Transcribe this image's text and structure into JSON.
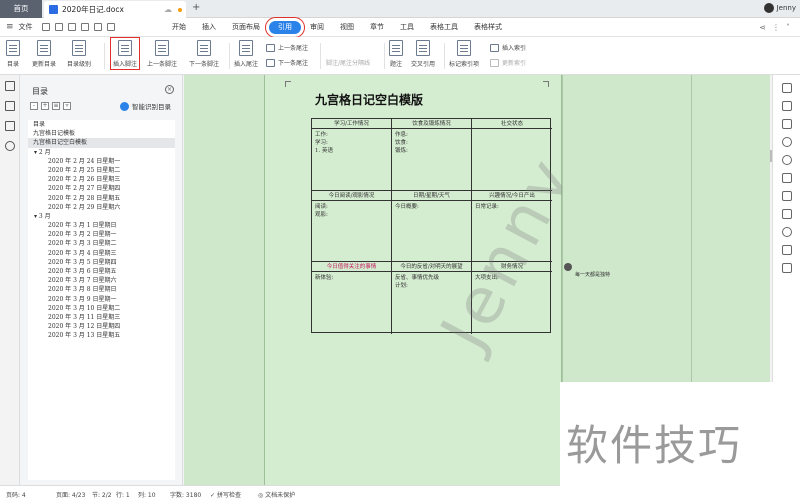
{
  "titlebar": {
    "home_tab": "首页",
    "doc_tab": "2020年日记.docx",
    "add_tab": "+",
    "user": "Jenny"
  },
  "menubar": {
    "file": "文件",
    "tabs": [
      "开始",
      "插入",
      "页面布局",
      "引用",
      "审阅",
      "视图",
      "章节",
      "工具",
      "表格工具",
      "表格样式"
    ],
    "active_tab": "引用"
  },
  "ribbon": {
    "toc": "目录",
    "update_toc": "更新目录",
    "toc_level": "目录级别",
    "insert_footnote": "插入脚注",
    "prev_footnote": "上一条脚注",
    "next_footnote": "下一条脚注",
    "insert_endnote": "插入尾注",
    "prev_endnote": "上一条尾注",
    "next_endnote": "下一条尾注",
    "separator": "脚注/尾注分隔线",
    "caption": "题注",
    "cross_ref": "交叉引用",
    "mark_index": "标记索引项",
    "insert_index": "插入索引",
    "update_index": "更新索引"
  },
  "toc_panel": {
    "title": "目录",
    "smart_label": "智能识别目录",
    "items": [
      {
        "text": "目录",
        "level": 1,
        "selected": false
      },
      {
        "text": "九宫格日记模板",
        "level": 1,
        "selected": false
      },
      {
        "text": "九宫格日记空白模板",
        "level": 1,
        "selected": true
      },
      {
        "text": "▾ 2 月",
        "level": 2,
        "selected": false
      },
      {
        "text": "2020 年 2 月 24 日星期一",
        "level": 3,
        "selected": false
      },
      {
        "text": "2020 年 2 月 25 日星期二",
        "level": 3,
        "selected": false
      },
      {
        "text": "2020 年 2 月 26 日星期三",
        "level": 3,
        "selected": false
      },
      {
        "text": "2020 年 2 月 27 日星期四",
        "level": 3,
        "selected": false
      },
      {
        "text": "2020 年 2 月 28 日星期五",
        "level": 3,
        "selected": false
      },
      {
        "text": "2020 年 2 月 29 日星期六",
        "level": 3,
        "selected": false
      },
      {
        "text": "▾ 3 月",
        "level": 2,
        "selected": false
      },
      {
        "text": "2020 年 3 月 1 日星期日",
        "level": 3,
        "selected": false
      },
      {
        "text": "2020 年 3 月 2 日星期一",
        "level": 3,
        "selected": false
      },
      {
        "text": "2020 年 3 月 3 日星期二",
        "level": 3,
        "selected": false
      },
      {
        "text": "2020 年 3 月 4 日星期三",
        "level": 3,
        "selected": false
      },
      {
        "text": "2020 年 3 月 5 日星期四",
        "level": 3,
        "selected": false
      },
      {
        "text": "2020 年 3 月 6 日星期五",
        "level": 3,
        "selected": false
      },
      {
        "text": "2020 年 3 月 7 日星期六",
        "level": 3,
        "selected": false
      },
      {
        "text": "2020 年 3 月 8 日星期日",
        "level": 3,
        "selected": false
      },
      {
        "text": "2020 年 3 月 9 日星期一",
        "level": 3,
        "selected": false
      },
      {
        "text": "2020 年 3 月 10 日星期二",
        "level": 3,
        "selected": false
      },
      {
        "text": "2020 年 3 月 11 日星期三",
        "level": 3,
        "selected": false
      },
      {
        "text": "2020 年 3 月 12 日星期四",
        "level": 3,
        "selected": false
      },
      {
        "text": "2020 年 3 月 13 日星期五",
        "level": 3,
        "selected": false
      }
    ]
  },
  "document": {
    "title": "九宫格日记空白模版",
    "watermark": "Jenny",
    "cells": [
      {
        "header": "学习/工作情况",
        "body": "工作:\n学习:\n1. 英语",
        "pink": false
      },
      {
        "header": "饮食及锻炼情况",
        "body": "作息:\n饮食:\n锻炼:",
        "pink": false
      },
      {
        "header": "社交状态",
        "body": "",
        "pink": false
      },
      {
        "header": "今日阅读/观影情况",
        "body": "阅读:\n观影:",
        "pink": false
      },
      {
        "header": "日期/星期/天气",
        "body": "今日概要:",
        "pink": false
      },
      {
        "header": "兴趣情况/今日产出",
        "body": "日常记录:",
        "pink": false
      },
      {
        "header": "今日值得关注的事情",
        "body": "新体验:",
        "pink": true
      },
      {
        "header": "今日的反省/对明天的展望",
        "body": "反省、事情优先级\n计划:",
        "pink": false
      },
      {
        "header": "财务情况",
        "body": "大项支出:",
        "pink": false
      }
    ],
    "comment": {
      "text": "每一天都是独特"
    }
  },
  "statusbar": {
    "page": "页码: 4",
    "pages": "页面: 4/23",
    "section": "节: 2/2",
    "row": "行: 1",
    "col": "列: 10",
    "words": "字数: 3180",
    "spell": "拼写检查",
    "protect": "文档未保护"
  },
  "overlay": {
    "brand": "软件技巧"
  }
}
